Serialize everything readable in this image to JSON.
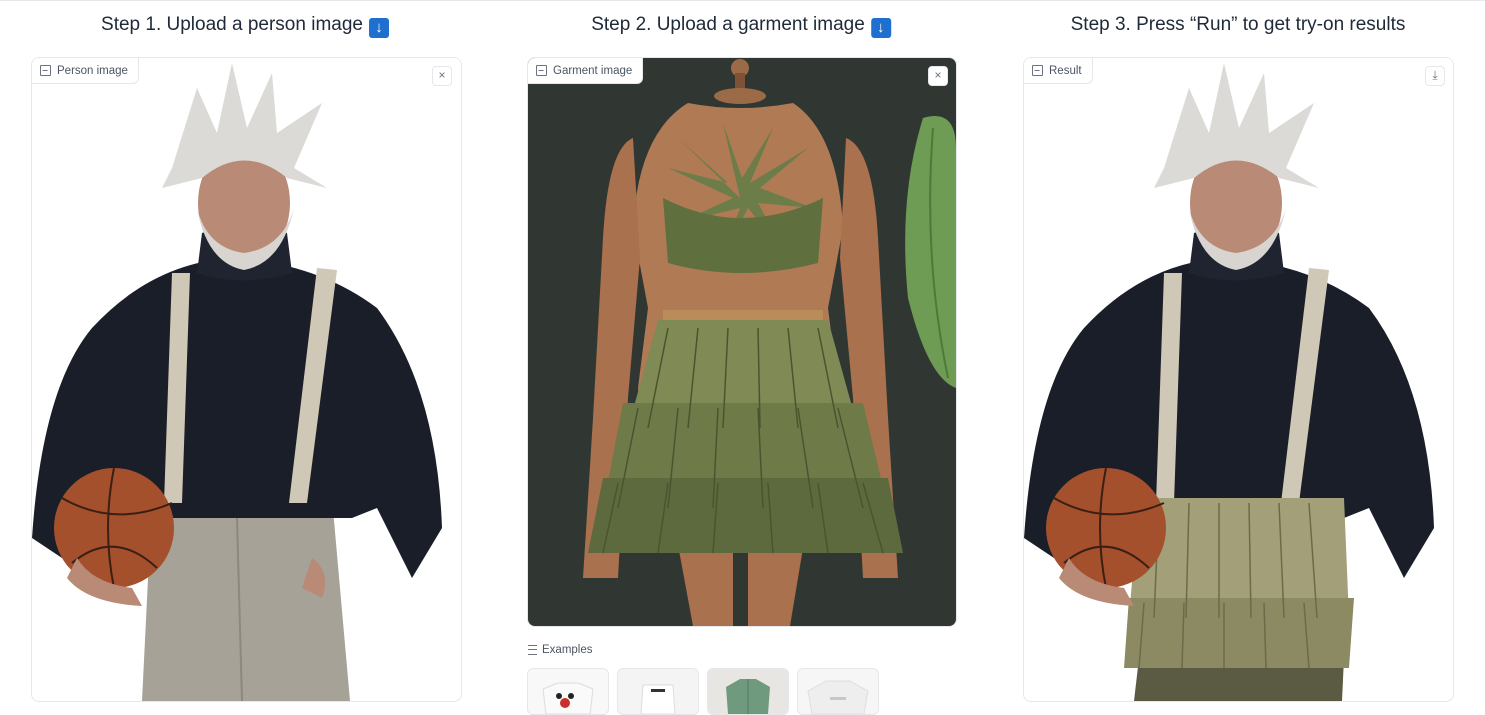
{
  "steps": {
    "step1": "Step 1. Upload a person image",
    "step2": "Step 2. Upload a garment image",
    "step3": "Step 3. Press “Run” to get try-on results",
    "arrow_emoji": "⬇️"
  },
  "person_panel": {
    "label": "Person image",
    "clear_icon": "×"
  },
  "garment_panel": {
    "label": "Garment image",
    "clear_icon": "×"
  },
  "result_panel": {
    "label": "Result",
    "download_icon": "⤓"
  },
  "examples": {
    "label": "Examples",
    "items": [
      "t-shirt-minnie",
      "white-crop-top",
      "green-shirt",
      "white-t-shirt"
    ]
  },
  "colors": {
    "accent_arrow": "#1e6fd0",
    "border": "#e5e7eb",
    "garment_bg": "#303733"
  }
}
